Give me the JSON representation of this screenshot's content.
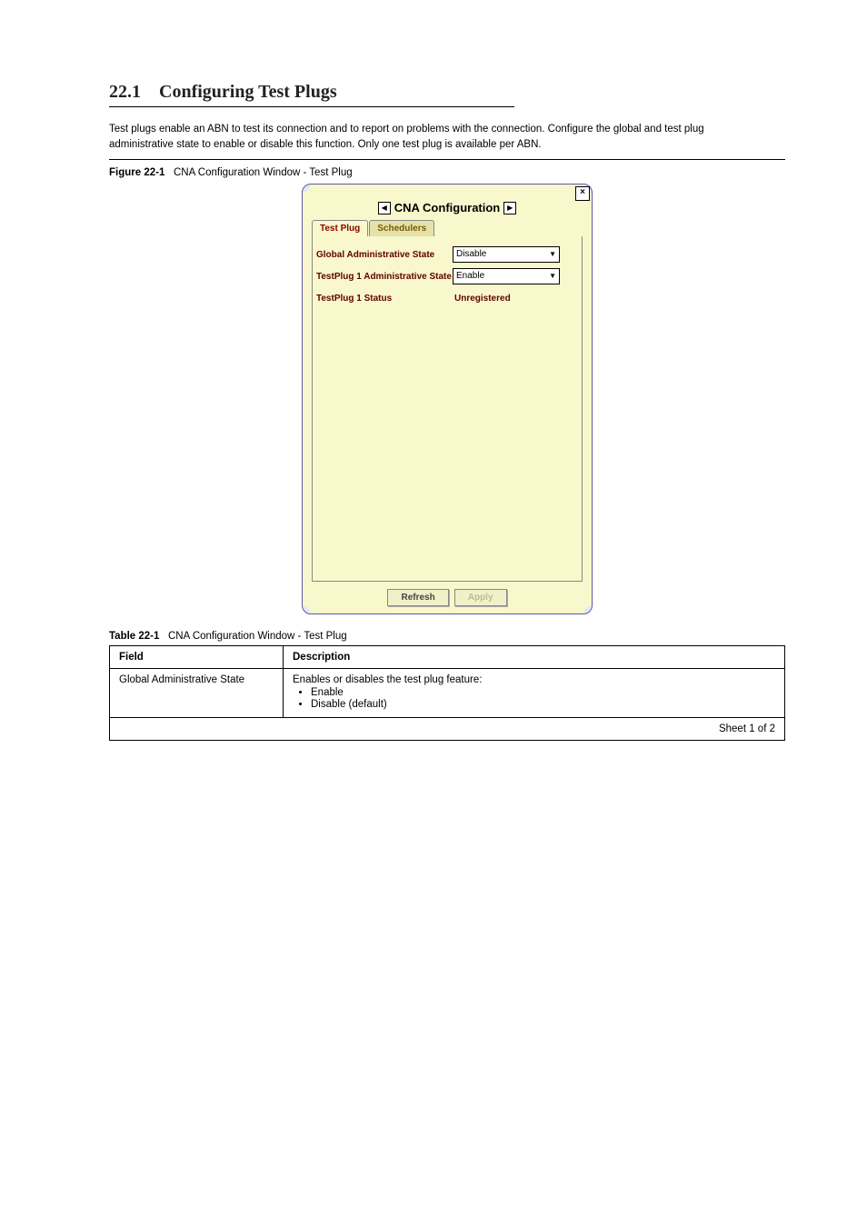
{
  "section": {
    "number": "22.1",
    "title": "Configuring Test Plugs"
  },
  "intro_para": "Test plugs enable an ABN to test its connection and to report on problems with the connection. Configure the global and test plug administrative state to enable or disable this function. Only one test plug is available per ABN.",
  "figure": {
    "label_prefix": "Figure 22-1",
    "label_rest": "CNA Configuration Window - Test Plug"
  },
  "window": {
    "title": "CNA Configuration",
    "close": "×",
    "nav_prev": "◀",
    "nav_next": "▶",
    "tabs": {
      "test_plug": "Test Plug",
      "schedulers": "Schedulers"
    },
    "rows": {
      "global_admin": {
        "label": "Global Administrative State",
        "value": "Disable"
      },
      "tp1_admin": {
        "label": "TestPlug 1 Administrative State",
        "value": "Enable"
      },
      "tp1_status": {
        "label": "TestPlug 1 Status",
        "value": "Unregistered"
      }
    },
    "buttons": {
      "refresh": "Refresh",
      "apply": "Apply"
    }
  },
  "table": {
    "label_prefix": "Table 22-1",
    "label_rest": "CNA Configuration Window - Test Plug",
    "header": {
      "field": "Field",
      "description": "Description"
    },
    "row1": {
      "field": "Global Administrative State",
      "desc_intro": "Enables or disables the test plug feature:",
      "opt1": "Enable",
      "opt2": "Disable (default)"
    },
    "row2": {
      "footer": "Sheet 1 of 2"
    }
  }
}
